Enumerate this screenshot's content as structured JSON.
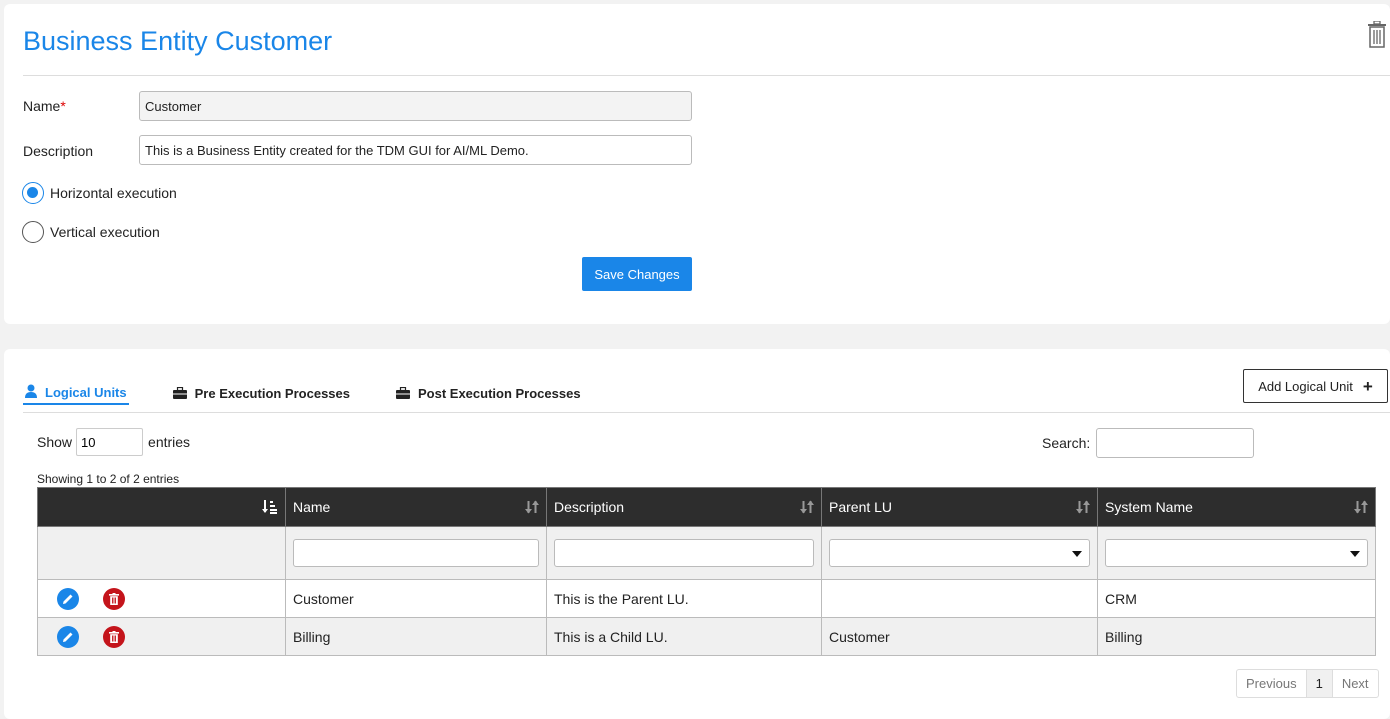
{
  "header": {
    "title": "Business Entity Customer"
  },
  "form": {
    "name_label": "Name",
    "name_required_mark": "*",
    "name_value": "Customer",
    "description_label": "Description",
    "description_value": "This is a Business Entity created for the TDM GUI for AI/ML Demo.",
    "execution_options": [
      {
        "label": "Horizontal execution",
        "checked": true
      },
      {
        "label": "Vertical execution",
        "checked": false
      }
    ],
    "save_label": "Save Changes"
  },
  "tabs": [
    {
      "label": "Logical Units",
      "icon": "user-icon",
      "active": true
    },
    {
      "label": "Pre Execution Processes",
      "icon": "briefcase-icon",
      "active": false
    },
    {
      "label": "Post Execution Processes",
      "icon": "briefcase-icon",
      "active": false
    }
  ],
  "add_logical_unit_label": "Add Logical Unit",
  "table_controls": {
    "show_label": "Show",
    "page_length": "10",
    "entries_label": "entries",
    "search_label": "Search:",
    "info": "Showing 1 to 2 of 2 entries"
  },
  "table": {
    "columns": [
      "Name",
      "Description",
      "Parent LU",
      "System Name"
    ],
    "rows": [
      {
        "name": "Customer",
        "description": "This is the Parent LU.",
        "parent_lu": "",
        "system_name": "CRM"
      },
      {
        "name": "Billing",
        "description": "This is a Child LU.",
        "parent_lu": "Customer",
        "system_name": "Billing"
      }
    ]
  },
  "pagination": {
    "previous": "Previous",
    "current": "1",
    "next": "Next"
  },
  "colors": {
    "accent": "#1a86e8",
    "delete": "#c4141b",
    "header_bg": "#2d2d2d"
  }
}
